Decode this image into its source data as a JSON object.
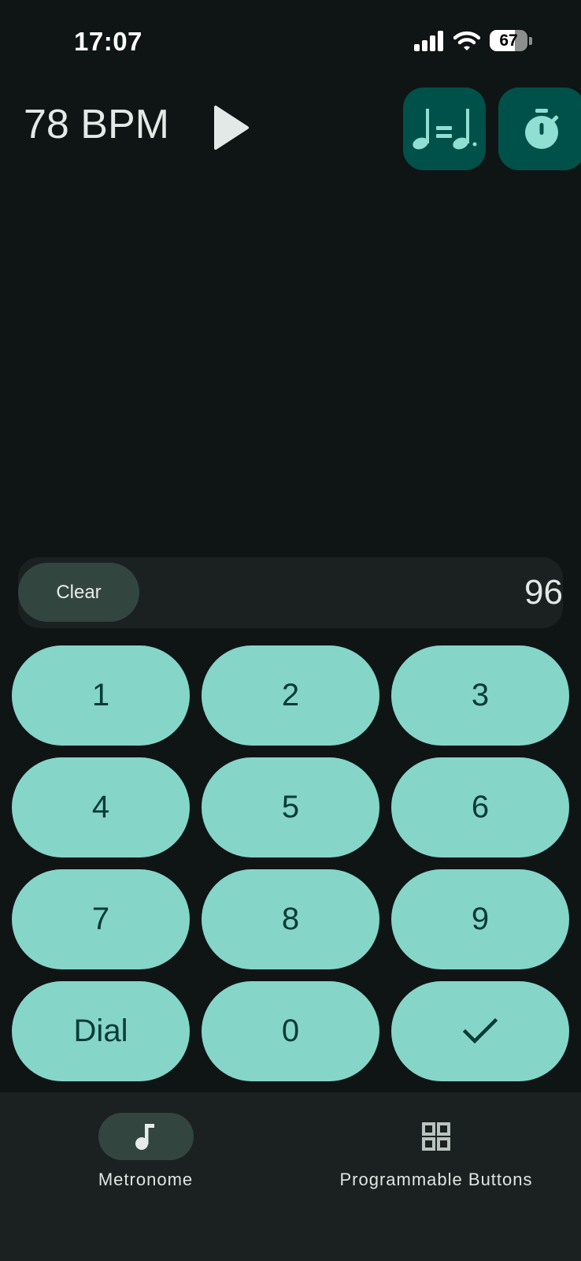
{
  "status_bar": {
    "time": "17:07",
    "battery": "67",
    "battery_level": 0.67
  },
  "header": {
    "bpm": "78 BPM",
    "play_icon": "play-icon",
    "tempo_equivalence_icon": "note-equals-dotted-note-icon",
    "timer_icon": "stopwatch-icon"
  },
  "entry": {
    "clear_label": "Clear",
    "value": "96"
  },
  "keypad": {
    "keys": [
      "1",
      "2",
      "3",
      "4",
      "5",
      "6",
      "7",
      "8",
      "9",
      "Dial",
      "0"
    ],
    "confirm_icon": "check-icon"
  },
  "bottom_nav": {
    "items": [
      {
        "label": "Metronome",
        "icon": "music-note-icon",
        "active": true
      },
      {
        "label": "Programmable Buttons",
        "icon": "grid-icon",
        "active": false
      }
    ]
  },
  "colors": {
    "background": "#0f1514",
    "key": "#86d5c9",
    "key_text": "#083b36",
    "tool_button": "#00514a",
    "accent_icon": "#8fe0d2",
    "surface": "#1b2120",
    "active_pill": "#33453f"
  }
}
